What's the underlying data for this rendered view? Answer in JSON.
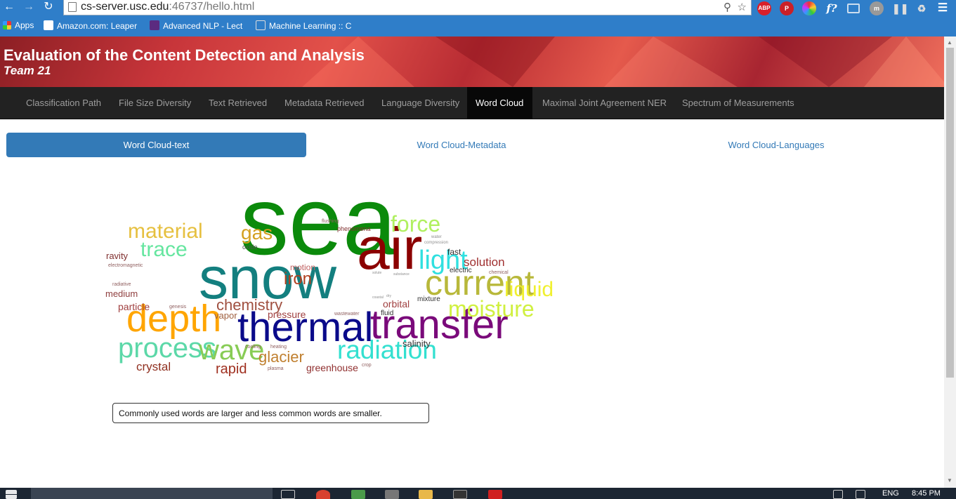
{
  "browser": {
    "url_host": "cs-server.usc.edu",
    "url_rest": ":46737/hello.html",
    "bookmarks": [
      {
        "label": "Apps"
      },
      {
        "label": "Amazon.com: Leaper"
      },
      {
        "label": "Advanced NLP - Lect"
      },
      {
        "label": "Machine Learning :: C"
      }
    ],
    "extensions": [
      "ABP",
      "f?"
    ]
  },
  "header": {
    "title": "Evaluation of the Content Detection and Analysis",
    "subtitle": "Team 21"
  },
  "nav": {
    "items": [
      {
        "label": "Classification Path"
      },
      {
        "label": "File Size Diversity"
      },
      {
        "label": "Text Retrieved"
      },
      {
        "label": "Metadata Retrieved"
      },
      {
        "label": "Language Diversity"
      },
      {
        "label": "Word Cloud"
      },
      {
        "label": "Maximal Joint Agreement NER"
      },
      {
        "label": "Spectrum of Measurements"
      }
    ],
    "active": "Word Cloud"
  },
  "pills": [
    {
      "label": "Word Cloud-text"
    },
    {
      "label": "Word Cloud-Metadata"
    },
    {
      "label": "Word Cloud-Languages"
    }
  ],
  "cloud": {
    "words": [
      {
        "text": "sea",
        "color": "#0b8a0b"
      },
      {
        "text": "snow",
        "color": "#137f7f"
      },
      {
        "text": "air",
        "color": "#8b0000"
      },
      {
        "text": "thermal",
        "color": "#0a0a8a"
      },
      {
        "text": "transfer",
        "color": "#7a0a7a"
      },
      {
        "text": "depth",
        "color": "#ffa500"
      },
      {
        "text": "current",
        "color": "#b8b83a"
      },
      {
        "text": "process",
        "color": "#5cd8a8"
      },
      {
        "text": "wave",
        "color": "#88cc55"
      },
      {
        "text": "radiation",
        "color": "#33e0d0"
      },
      {
        "text": "material",
        "color": "#e6c040"
      },
      {
        "text": "trace",
        "color": "#66e6a0"
      },
      {
        "text": "force",
        "color": "#b0f060"
      },
      {
        "text": "gas",
        "color": "#d4a020"
      },
      {
        "text": "light",
        "color": "#30e0e0"
      },
      {
        "text": "liquid",
        "color": "#f0f030"
      },
      {
        "text": "moisture",
        "color": "#d0f040"
      },
      {
        "text": "chemistry",
        "color": "#a05040"
      },
      {
        "text": "iron",
        "color": "#b04020"
      },
      {
        "text": "glacier",
        "color": "#c08030"
      },
      {
        "text": "rapid",
        "color": "#a03020"
      },
      {
        "text": "crystal",
        "color": "#903020"
      },
      {
        "text": "greenhouse",
        "color": "#903030"
      },
      {
        "text": "solution",
        "color": "#a03030"
      },
      {
        "text": "salinity",
        "color": "#303030"
      },
      {
        "text": "pressure",
        "color": "#a04040"
      },
      {
        "text": "orbital",
        "color": "#a04040"
      },
      {
        "text": "particle",
        "color": "#a04040"
      },
      {
        "text": "medium",
        "color": "#904040"
      },
      {
        "text": "ravity",
        "color": "#803030"
      },
      {
        "text": "motion",
        "color": "#c06060"
      },
      {
        "text": "vapor",
        "color": "#a06040"
      },
      {
        "text": "fast",
        "color": "#303030"
      },
      {
        "text": "electric",
        "color": "#303030"
      },
      {
        "text": "mixture",
        "color": "#303030"
      },
      {
        "text": "fluid",
        "color": "#303030"
      },
      {
        "text": "phenomena",
        "color": "#803030"
      },
      {
        "text": "electromagnetic",
        "color": "#906060"
      },
      {
        "text": "radiative",
        "color": "#906060"
      },
      {
        "text": "genesis",
        "color": "#906060"
      },
      {
        "text": "wastewater",
        "color": "#906060"
      },
      {
        "text": "chemical",
        "color": "#906060"
      },
      {
        "text": "flushing",
        "color": "#906060"
      },
      {
        "text": "cooling",
        "color": "#906060"
      },
      {
        "text": "heating",
        "color": "#906060"
      },
      {
        "text": "plasma",
        "color": "#906060"
      },
      {
        "text": "crop",
        "color": "#906060"
      },
      {
        "text": "oxide",
        "color": "#505050"
      },
      {
        "text": "water",
        "color": "#909090"
      },
      {
        "text": "compression",
        "color": "#909090"
      },
      {
        "text": "substance",
        "color": "#909090"
      },
      {
        "text": "solute",
        "color": "#909090"
      },
      {
        "text": "dry",
        "color": "#909090"
      },
      {
        "text": "coastal",
        "color": "#909090"
      }
    ]
  },
  "caption": "Commonly used words are larger and less common words are smaller.",
  "taskbar": {
    "lang": "ENG",
    "time": "8:45 PM"
  },
  "colors": {
    "accent": "#337ab7",
    "navbar": "#222222",
    "chrome": "#2f7ec9"
  }
}
